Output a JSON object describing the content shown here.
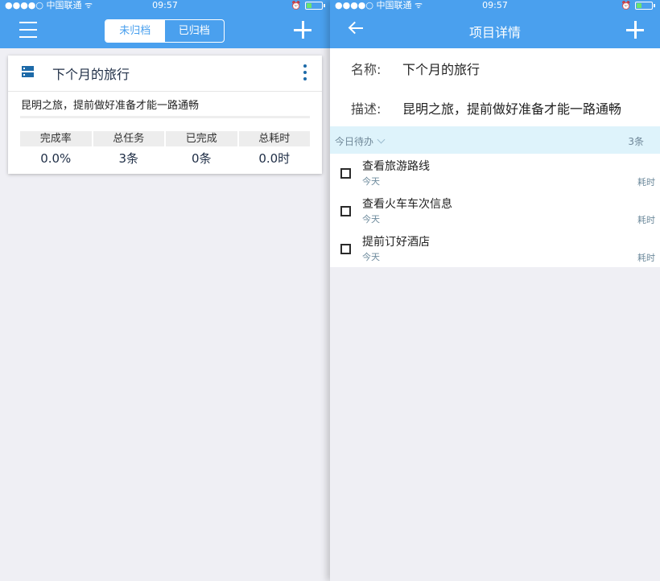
{
  "status_bar": {
    "carrier": "●●●●○ 中国联通 ᯤ",
    "time": "09:57"
  },
  "project_list": {
    "tabs": [
      {
        "label": "未归档"
      },
      {
        "label": "已归档"
      }
    ],
    "project": {
      "title": "下个月的旅行",
      "description": "昆明之旅，提前做好准备才能一路通畅",
      "progress_fraction": 0.0,
      "stats": [
        {
          "label": "完成率",
          "value": "0.0%"
        },
        {
          "label": "总任务",
          "value": "3条"
        },
        {
          "label": "已完成",
          "value": "0条"
        },
        {
          "label": "总耗时",
          "value": "0.0时"
        }
      ]
    }
  },
  "project_detail": {
    "title": "项目详情",
    "name_label": "名称:",
    "name_value": "下个月的旅行",
    "desc_label": "描述:",
    "desc_value": "昆明之旅，提前做好准备才能一路通畅",
    "section_label": "今日待办",
    "section_count": "3条",
    "tasks": [
      {
        "title": "查看旅游路线",
        "date": "今天",
        "duration": "耗时"
      },
      {
        "title": "查看火车车次信息",
        "date": "今天",
        "duration": "耗时"
      },
      {
        "title": "提前订好酒店",
        "date": "今天",
        "duration": "耗时"
      }
    ]
  },
  "colors": {
    "accent": "#4aa0ee",
    "icon_blue": "#1d6aa8",
    "section_bg": "#def3fb"
  }
}
